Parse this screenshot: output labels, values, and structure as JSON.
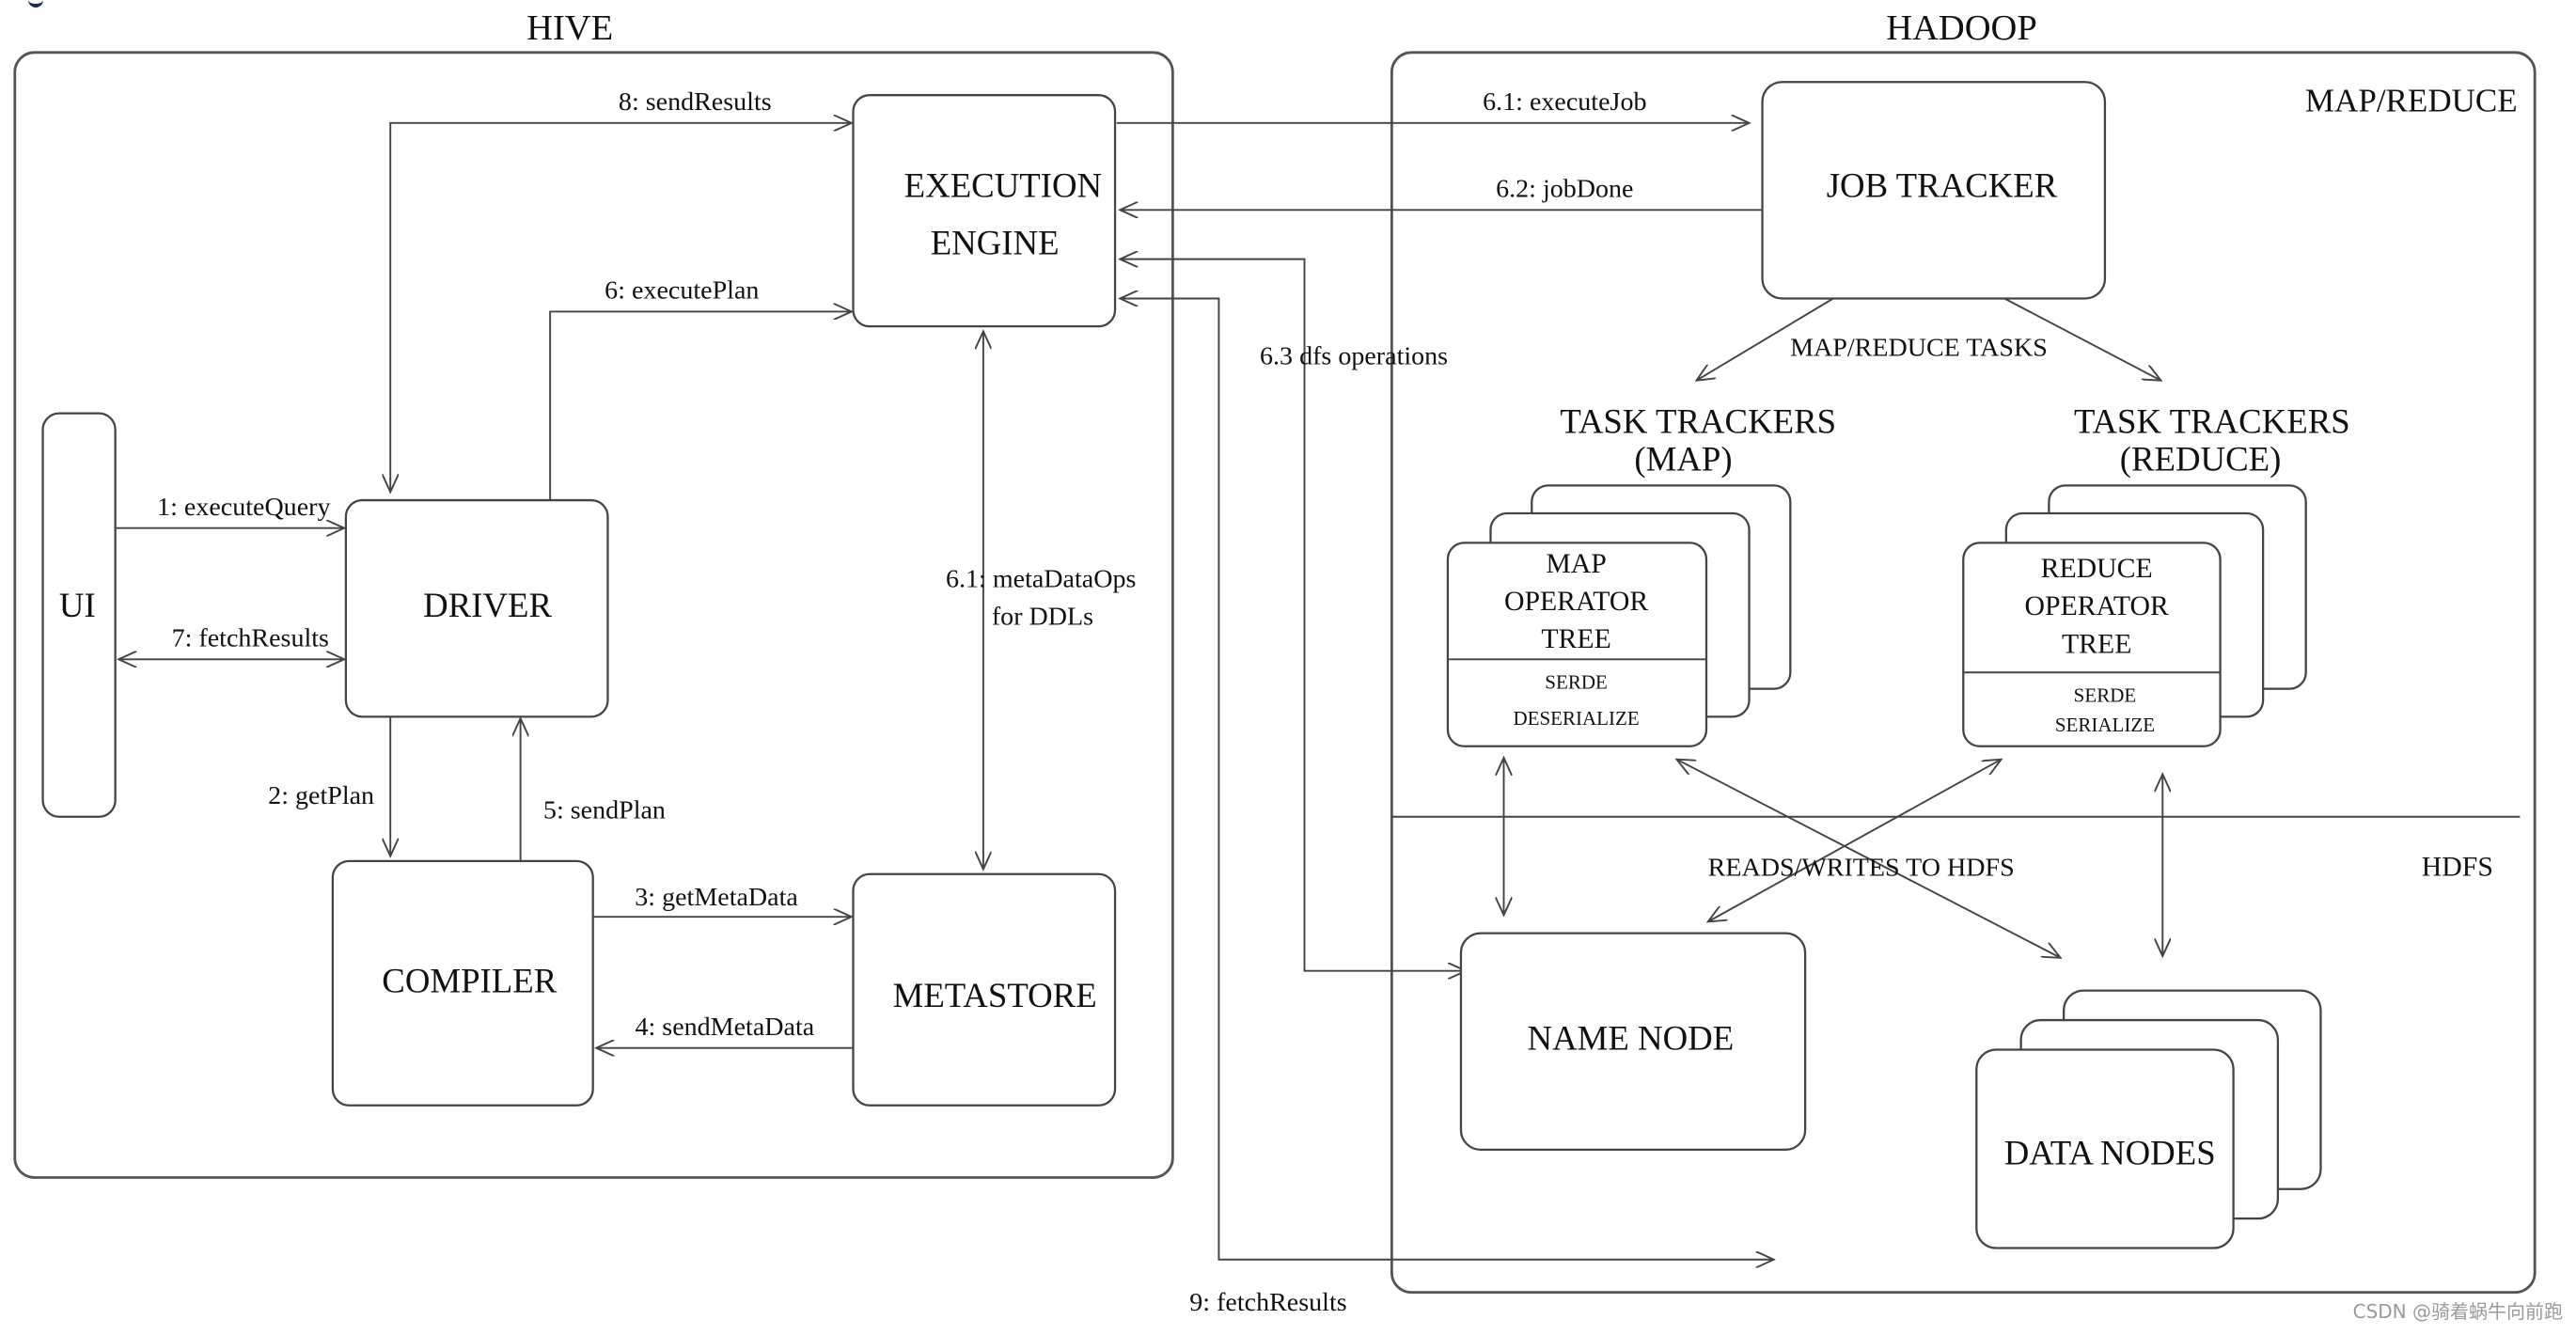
{
  "sections": {
    "hive": "HIVE",
    "hadoop": "HADOOP",
    "map_reduce": "MAP/REDUCE",
    "hdfs": "HDFS"
  },
  "components": {
    "ui": "UI",
    "driver": "DRIVER",
    "compiler": "COMPILER",
    "metastore": "METASTORE",
    "execution_engine": [
      "EXECUTION",
      "ENGINE"
    ],
    "job_tracker": "JOB TRACKER",
    "task_trackers_map": [
      "TASK TRACKERS",
      "(MAP)"
    ],
    "task_trackers_reduce": [
      "TASK TRACKERS",
      "(REDUCE)"
    ],
    "map_operator_tree": [
      "MAP",
      "OPERATOR",
      "TREE"
    ],
    "map_serde": [
      "SERDE",
      "DESERIALIZE"
    ],
    "reduce_operator_tree": [
      "REDUCE",
      "OPERATOR",
      "TREE"
    ],
    "reduce_serde": [
      "SERDE",
      "SERIALIZE"
    ],
    "name_node": "NAME NODE",
    "data_nodes": "DATA NODES"
  },
  "edges": {
    "e1": "1: executeQuery",
    "e2": "2: getPlan",
    "e3": "3: getMetaData",
    "e4": "4: sendMetaData",
    "e5": "5: sendPlan",
    "e6": "6: executePlan",
    "e6_1_job": "6.1: executeJob",
    "e6_1_meta": [
      "6.1: metaDataOps",
      "for DDLs"
    ],
    "e6_2": "6.2: jobDone",
    "e6_3": "6.3 dfs operations",
    "e7": "7: fetchResults",
    "e8": "8: sendResults",
    "e9": "9: fetchResults",
    "map_reduce_tasks": "MAP/REDUCE TASKS",
    "reads_writes": "READS/WRITES TO HDFS"
  },
  "watermark": "CSDN @骑着蜗牛向前跑"
}
